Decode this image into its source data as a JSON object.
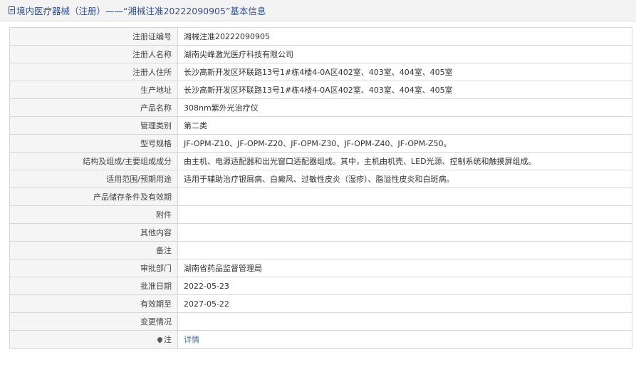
{
  "header": {
    "title": "境内医疗器械（注册）——“湘械注准20222090905”基本信息"
  },
  "rows": [
    {
      "label": "注册证编号",
      "value": "湘械注准20222090905"
    },
    {
      "label": "注册人名称",
      "value": "湖南尖峰激光医疗科技有限公司"
    },
    {
      "label": "注册人住所",
      "value": "长沙高新开发区环联路13号1#栋4楼4-0A区402室、403室、404室、405室"
    },
    {
      "label": "生产地址",
      "value": "长沙高新开发区环联路13号1#栋4楼4-0A区402室、403室、404室、405室"
    },
    {
      "label": "产品名称",
      "value": "308nm紫外光治疗仪"
    },
    {
      "label": "管理类别",
      "value": "第二类"
    },
    {
      "label": "型号规格",
      "value": "JF-OPM-Z10、JF-OPM-Z20、JF-OPM-Z30、JF-OPM-Z40、JF-OPM-Z50。"
    },
    {
      "label": "结构及组成/主要组成成分",
      "value": "由主机、电源适配器和出光窗口适配器组成。其中，主机由机壳、LED光源、控制系统和触摸屏组成。"
    },
    {
      "label": "适用范围/预期用途",
      "value": "适用于辅助治疗银屑病、白癜风、过敏性皮炎（湿疹）、脂溢性皮炎和白斑病。"
    },
    {
      "label": "产品储存条件及有效期",
      "value": ""
    },
    {
      "label": "附件",
      "value": ""
    },
    {
      "label": "其他内容",
      "value": ""
    },
    {
      "label": "备注",
      "value": ""
    },
    {
      "label": "审批部门",
      "value": "湖南省药品监督管理局"
    },
    {
      "label": "批准日期",
      "value": "2022-05-23"
    },
    {
      "label": "有效期至",
      "value": "2027-05-22"
    },
    {
      "label": "变更情况",
      "value": ""
    },
    {
      "label": "注",
      "value": "详情"
    }
  ],
  "icons": {
    "header_icon": "document-icon",
    "note_icon": "pin-icon"
  },
  "colors": {
    "link": "#3a6fb5",
    "header_text": "#2f4f8f"
  }
}
